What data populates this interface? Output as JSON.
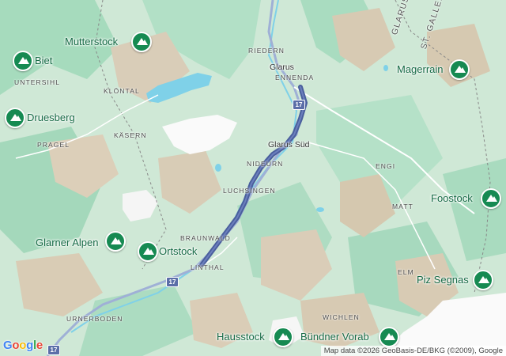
{
  "map": {
    "attribution": "Map data ©2026 GeoBasis-DE/BKG (©2009), Google",
    "logo": {
      "g1": "G",
      "o1": "o",
      "o2": "o",
      "g2": "g",
      "l": "l",
      "e": "e"
    },
    "colors": {
      "valley": "#cfe8d6",
      "forest": "#a6dbbd",
      "rock": "#d9cdb8",
      "snow": "#fafafa",
      "lake": "#7fd1e8",
      "route": "#4a5f9d",
      "road": "#9fb0d6",
      "peak": "#168a52"
    },
    "cantons": {
      "glarus": "GLARUS",
      "st_gallen": "ST. GALLEN"
    },
    "road_shields": [
      "17",
      "17",
      "17"
    ],
    "towns": {
      "glarus": "Glarus",
      "glarus_sud": "Glarus Süd"
    },
    "villages": {
      "riedern": "RIEDERN",
      "ennenda": "ENNENDA",
      "untersihl": "UNTERSIHL",
      "klontal": "KLÖNTAL",
      "kasern": "KÄSERN",
      "pragel": "PRAGEL",
      "nideurn": "NIDEURN",
      "luchsingen": "LUCHSINGEN",
      "braunwald": "BRAUNWALD",
      "linthal": "LINTHAL",
      "urnerboden": "URNERBODEN",
      "engi": "ENGI",
      "matt": "MATT",
      "elm": "ELM",
      "wichlen": "WICHLEN"
    },
    "peaks": {
      "mutterstock": "Mutterstock",
      "biet": "Biet",
      "druesberg": "Druesberg",
      "magerrain": "Magerrain",
      "foostock": "Foostock",
      "glarner_alpen": "Glarner Alpen",
      "ortstock": "Ortstock",
      "piz_segnas": "Piz Segnas",
      "hausstock": "Hausstock",
      "bundner_vorab": "Bündner Vorab"
    }
  }
}
